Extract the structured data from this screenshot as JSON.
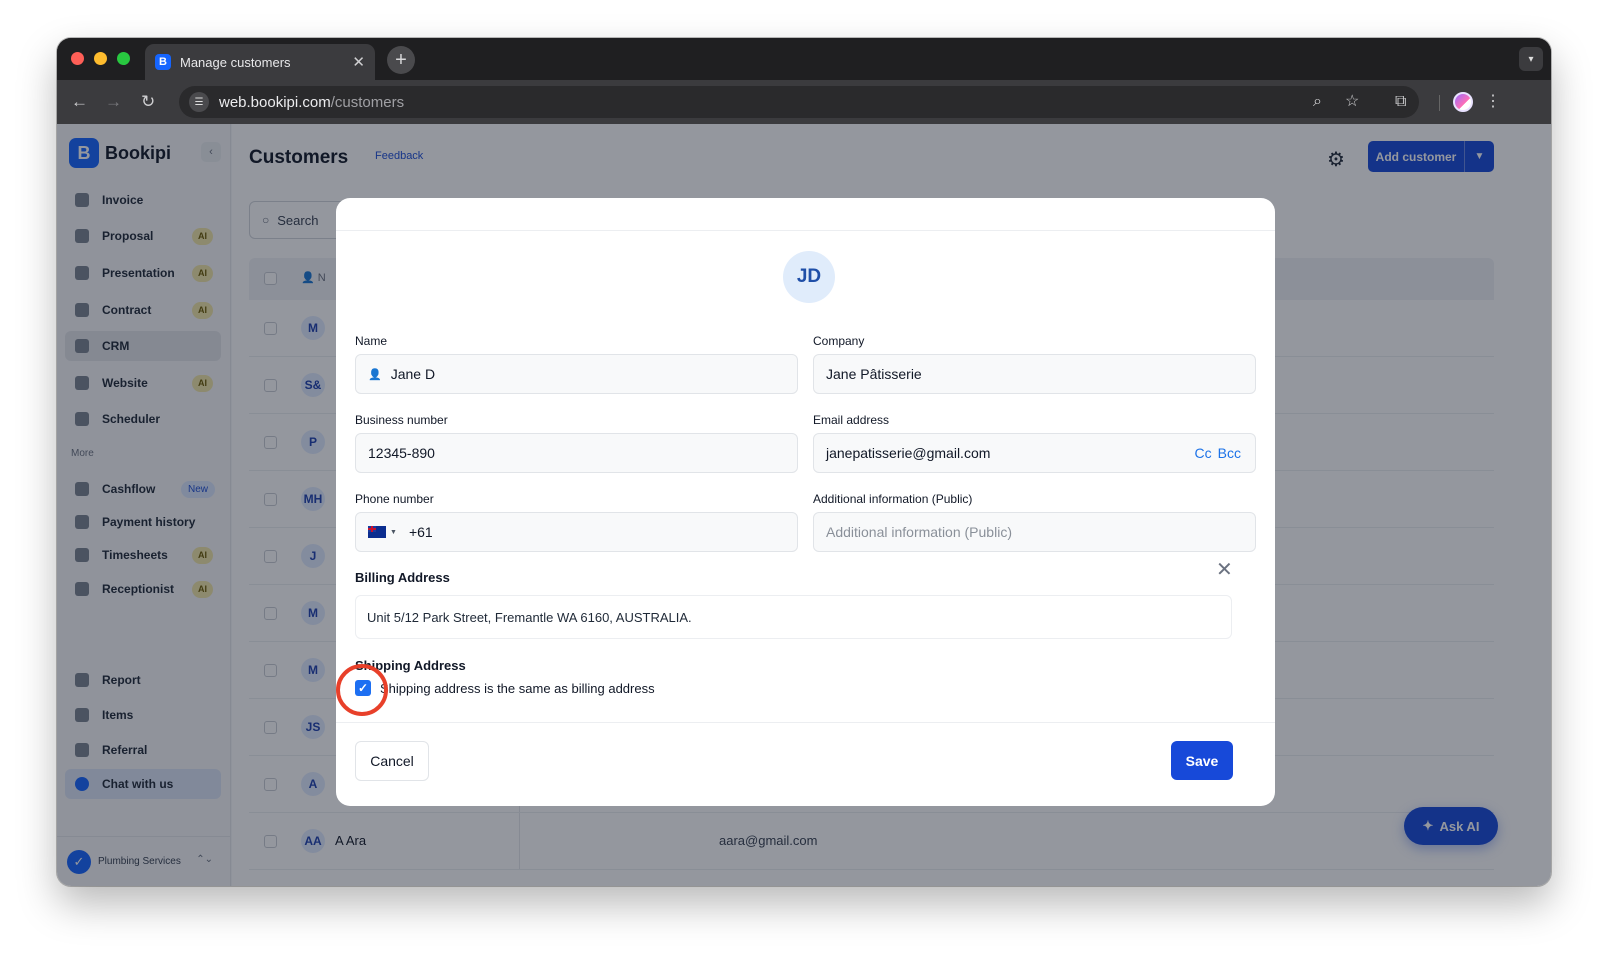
{
  "browser": {
    "tab_title": "Manage customers",
    "favicon_letter": "B",
    "url_host": "web.bookipi.com",
    "url_path": "/customers"
  },
  "sidebar": {
    "brand": "Bookipi",
    "items": [
      {
        "label": "Invoice",
        "badge": ""
      },
      {
        "label": "Proposal",
        "badge": "AI"
      },
      {
        "label": "Presentation",
        "badge": "AI"
      },
      {
        "label": "Contract",
        "badge": "AI"
      },
      {
        "label": "CRM",
        "badge": ""
      },
      {
        "label": "Website",
        "badge": "AI"
      },
      {
        "label": "Scheduler",
        "badge": ""
      }
    ],
    "more_label": "More",
    "more_items": [
      {
        "label": "Cashflow",
        "badge": "New"
      },
      {
        "label": "Payment history",
        "badge": ""
      },
      {
        "label": "Timesheets",
        "badge": "AI"
      },
      {
        "label": "Receptionist",
        "badge": "AI"
      }
    ],
    "bottom_items": [
      {
        "label": "Report"
      },
      {
        "label": "Items"
      },
      {
        "label": "Referral"
      },
      {
        "label": "Chat with us"
      }
    ],
    "workspace": "Plumbing Services"
  },
  "header": {
    "title": "Customers",
    "feedback": "Feedback",
    "add_customer": "Add customer"
  },
  "search": {
    "placeholder": "Search"
  },
  "table": {
    "name_header": "N",
    "rows": [
      {
        "initials": "M",
        "name": "",
        "email": ""
      },
      {
        "initials": "S&",
        "name": "",
        "email": ""
      },
      {
        "initials": "P",
        "name": "",
        "email": ""
      },
      {
        "initials": "MH",
        "name": "",
        "email": ""
      },
      {
        "initials": "J",
        "name": "",
        "email": ""
      },
      {
        "initials": "M",
        "name": "",
        "email": ""
      },
      {
        "initials": "M",
        "name": "",
        "email": ""
      },
      {
        "initials": "JS",
        "name": "",
        "email": ""
      },
      {
        "initials": "A",
        "name": "",
        "email": ""
      },
      {
        "initials": "AA",
        "name": "A Ara",
        "email": "aara@gmail.com"
      }
    ]
  },
  "ask_ai": "Ask AI",
  "modal": {
    "avatar": "JD",
    "name_label": "Name",
    "name_value": "Jane D",
    "company_label": "Company",
    "company_value": "Jane Pâtisserie",
    "business_label": "Business number",
    "business_value": "12345-890",
    "email_label": "Email address",
    "email_value": "janepatisserie@gmail.com",
    "cc": "Cc",
    "bcc": "Bcc",
    "phone_label": "Phone number",
    "phone_value": "+61",
    "additional_label": "Additional information (Public)",
    "additional_placeholder": "Additional information (Public)",
    "billing_title": "Billing Address",
    "billing_value": "Unit 5/12 Park Street, Fremantle WA 6160, AUSTRALIA.",
    "shipping_title": "Shipping Address",
    "shipping_same": "Shipping address is the same as billing address",
    "cancel": "Cancel",
    "save": "Save"
  }
}
